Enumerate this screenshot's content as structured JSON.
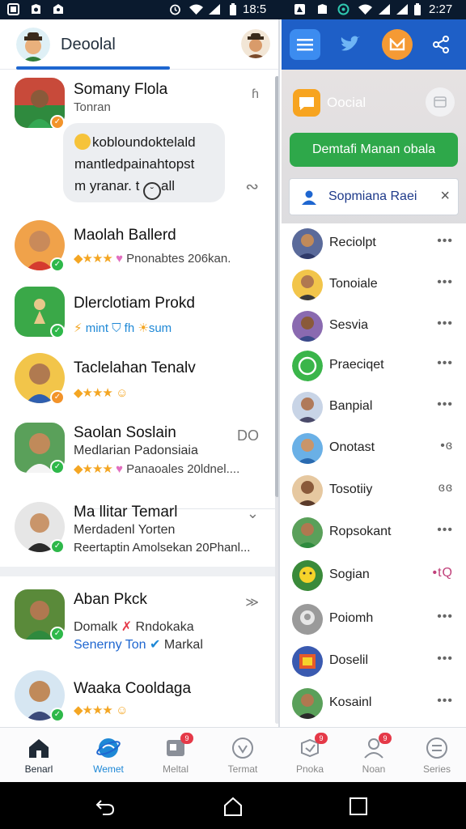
{
  "status_bar": {
    "left_time": "18:5",
    "right_time": "2:27"
  },
  "header": {
    "title": "Deoolal"
  },
  "chats": [
    {
      "name": "Somany Flola",
      "sub": "Tonran",
      "meta": "ɦ"
    },
    {
      "name": "Maolah Ballerd",
      "rating_text": "Pnonabtes 206kan."
    },
    {
      "name": "Dlerclotiam Prokd",
      "sub_a": "mint",
      "sub_b": "fh",
      "sub_c": "sum"
    },
    {
      "name": "Taclelahan Tenalv"
    },
    {
      "name": "Saolan Soslain",
      "sub": "Medlarian Padonsiaia",
      "rating_text": "Panaoales 20ldnel....",
      "meta": "DO"
    },
    {
      "name": "Ma llitar Temarl",
      "sub": "Merdadenl Yorten",
      "sub2": "Reertaptin Amolsekan 20Phanl...",
      "meta": "⌄"
    },
    {
      "name": "Aban Pkck",
      "sub": "Domalk",
      "sub_b": "Rndokaka",
      "sub2": "Senerny Ton",
      "sub2_b": "Markal",
      "meta": "≫"
    },
    {
      "name": "Waaka Cooldaga"
    }
  ],
  "bubble": {
    "line1": "kobloundoktelald",
    "line2": "mantledpainahtopst",
    "line3": "m yranar. t",
    "line3_end": "all",
    "meta": "∾"
  },
  "right_panel": {
    "official_label": "Oocial",
    "green_button": "Demtafi Manan obala",
    "search_text": "Sopmiana Raei",
    "search_clear": "×",
    "contacts": [
      {
        "name": "Reciolpt",
        "more": "•••"
      },
      {
        "name": "Tonoiale",
        "more": "•••"
      },
      {
        "name": "Sesvia",
        "more": "•••"
      },
      {
        "name": "Praeciqet",
        "more": "•••"
      },
      {
        "name": "Banpial",
        "more": "•••"
      },
      {
        "name": "Onotast",
        "more": "•ɞ"
      },
      {
        "name": "Tosotiiy",
        "more": "ɞɞ"
      },
      {
        "name": "Ropsokant",
        "more": "•••"
      },
      {
        "name": "Sogian",
        "more": "•tQ"
      },
      {
        "name": "Poiomh",
        "more": "•••"
      },
      {
        "name": "Doselil",
        "more": "•••"
      },
      {
        "name": "Kosainl",
        "more": "•••"
      }
    ]
  },
  "bottom_nav": [
    {
      "label": "Benarl",
      "icon": "home-icon"
    },
    {
      "label": "Wemet",
      "icon": "globe-icon"
    },
    {
      "label": "Meltal",
      "icon": "media-icon",
      "badge": "9"
    },
    {
      "label": "Termat",
      "icon": "compass-icon"
    },
    {
      "label": "Pnoka",
      "icon": "tag-icon",
      "badge": "9"
    },
    {
      "label": "Noan",
      "icon": "person-icon",
      "badge": "9"
    },
    {
      "label": "Series",
      "icon": "swap-icon"
    }
  ],
  "colors": {
    "brand_blue": "#1e5fc7",
    "accent_green": "#2ea84a",
    "accent_orange": "#f7a420"
  }
}
